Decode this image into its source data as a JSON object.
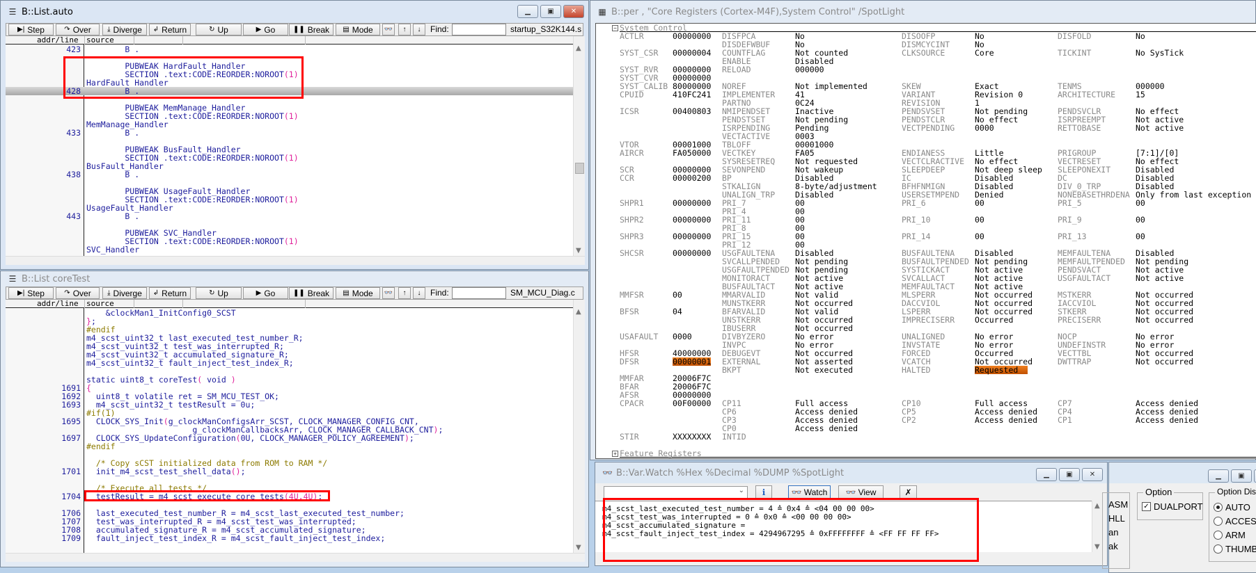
{
  "toolbar": {
    "step": "Step",
    "over": "Over",
    "diverge": "Diverge",
    "return": "Return",
    "up": "Up",
    "go": "Go",
    "break": "Break",
    "mode": "Mode",
    "find": "Find:"
  },
  "list_header": {
    "addr": "addr/line",
    "source": "source"
  },
  "list_top": {
    "title": "B::List.auto",
    "file": "startup_S32K144.s",
    "lines": [
      {
        "n": "423",
        "t": "        B ."
      },
      {
        "n": "",
        "t": ""
      },
      {
        "n": "",
        "t": "        PUBWEAK HardFault_Handler"
      },
      {
        "n": "",
        "t": "        SECTION .text:CODE:REORDER:NOROOT(1)"
      },
      {
        "n": "",
        "t": "HardFault_Handler"
      },
      {
        "n": "428",
        "t": "        B .",
        "cur": true
      },
      {
        "n": "",
        "t": ""
      },
      {
        "n": "",
        "t": "        PUBWEAK MemManage_Handler"
      },
      {
        "n": "",
        "t": "        SECTION .text:CODE:REORDER:NOROOT(1)"
      },
      {
        "n": "",
        "t": "MemManage_Handler"
      },
      {
        "n": "433",
        "t": "        B ."
      },
      {
        "n": "",
        "t": ""
      },
      {
        "n": "",
        "t": "        PUBWEAK BusFault_Handler"
      },
      {
        "n": "",
        "t": "        SECTION .text:CODE:REORDER:NOROOT(1)"
      },
      {
        "n": "",
        "t": "BusFault_Handler"
      },
      {
        "n": "438",
        "t": "        B ."
      },
      {
        "n": "",
        "t": ""
      },
      {
        "n": "",
        "t": "        PUBWEAK UsageFault_Handler"
      },
      {
        "n": "",
        "t": "        SECTION .text:CODE:REORDER:NOROOT(1)"
      },
      {
        "n": "",
        "t": "UsageFault_Handler"
      },
      {
        "n": "443",
        "t": "        B ."
      },
      {
        "n": "",
        "t": ""
      },
      {
        "n": "",
        "t": "        PUBWEAK SVC_Handler"
      },
      {
        "n": "",
        "t": "        SECTION .text:CODE:REORDER:NOROOT(1)"
      },
      {
        "n": "",
        "t": "SVC_Handler"
      }
    ]
  },
  "list_bottom": {
    "title": "B::List coreTest",
    "file": "SM_MCU_Diag.c",
    "lines": [
      {
        "n": "",
        "t": "    &clockMan1_InitConfig0_SCST"
      },
      {
        "n": "",
        "t": "};"
      },
      {
        "n": "",
        "t": "#endif"
      },
      {
        "n": "",
        "t": "m4_scst_uint32_t last_executed_test_number_R;"
      },
      {
        "n": "",
        "t": "m4_scst_vuint32_t test_was_interrupted_R;"
      },
      {
        "n": "",
        "t": "m4_scst_vuint32_t accumulated_signature_R;"
      },
      {
        "n": "",
        "t": "m4_scst_uint32_t fault_inject_test_index_R;"
      },
      {
        "n": "",
        "t": ""
      },
      {
        "n": "",
        "t": "static uint8_t coreTest( void )"
      },
      {
        "n": "1691",
        "t": "{"
      },
      {
        "n": "1692",
        "t": "  uint8_t volatile ret = SM_MCU_TEST_OK;"
      },
      {
        "n": "1693",
        "t": "  m4_scst_uint32_t testResult = 0u;"
      },
      {
        "n": "",
        "t": "#if(1)"
      },
      {
        "n": "1695",
        "t": "  CLOCK_SYS_Init(g_clockManConfigsArr_SCST, CLOCK_MANAGER_CONFIG_CNT,"
      },
      {
        "n": "",
        "t": "                      g_clockManCallbacksArr, CLOCK_MANAGER_CALLBACK_CNT);"
      },
      {
        "n": "1697",
        "t": "  CLOCK_SYS_UpdateConfiguration(0U, CLOCK_MANAGER_POLICY_AGREEMENT);"
      },
      {
        "n": "",
        "t": "#endif"
      },
      {
        "n": "",
        "t": ""
      },
      {
        "n": "",
        "t": "  /* Copy sCST initialized data from ROM to RAM */"
      },
      {
        "n": "1701",
        "t": "  init_m4_scst_test_shell_data();"
      },
      {
        "n": "",
        "t": ""
      },
      {
        "n": "",
        "t": "  /* Execute all tests */"
      },
      {
        "n": "1704",
        "t": "  testResult = m4_scst_execute_core_tests(4U,4U);"
      },
      {
        "n": "",
        "t": ""
      },
      {
        "n": "1706",
        "t": "  last_executed_test_number_R = m4_scst_last_executed_test_number;"
      },
      {
        "n": "1707",
        "t": "  test_was_interrupted_R = m4_scst_test_was_interrupted;"
      },
      {
        "n": "1708",
        "t": "  accumulated_signature_R = m4_scst_accumulated_signature;"
      },
      {
        "n": "1709",
        "t": "  fault_inject_test_index_R = m4_scst_fault_inject_test_index;"
      }
    ]
  },
  "registers": {
    "title": "B::per , \"Core Registers (Cortex-M4F),System Control\" /SpotLight",
    "section": "System Control",
    "footer_section": "Feature Registers",
    "rows": [
      {
        "r": "ACTLR",
        "v": "00000000",
        "f": [
          [
            "DISFPCA",
            "No"
          ],
          [
            "DISOOFP",
            "No"
          ],
          [
            "DISFOLD",
            "No"
          ]
        ]
      },
      {
        "r": "",
        "v": "",
        "f": [
          [
            "DISDEFWBUF",
            "No"
          ],
          [
            "DISMCYCINT",
            "No"
          ]
        ]
      },
      {
        "r": "SYST_CSR",
        "v": "00000004",
        "f": [
          [
            "COUNTFLAG",
            "Not counted"
          ],
          [
            "CLKSOURCE",
            "Core"
          ],
          [
            "TICKINT",
            "No SysTick"
          ]
        ]
      },
      {
        "r": "",
        "v": "",
        "f": [
          [
            "ENABLE",
            "Disabled"
          ]
        ]
      },
      {
        "r": "SYST_RVR",
        "v": "00000000",
        "f": [
          [
            "RELOAD",
            "000000"
          ]
        ]
      },
      {
        "r": "SYST_CVR",
        "v": "00000000",
        "f": []
      },
      {
        "r": "SYST_CALIB",
        "v": "80000000",
        "f": [
          [
            "NOREF",
            "Not implemented"
          ],
          [
            "SKEW",
            "Exact"
          ],
          [
            "TENMS",
            "000000"
          ]
        ]
      },
      {
        "r": "CPUID",
        "v": "410FC241",
        "f": [
          [
            "IMPLEMENTER",
            "41"
          ],
          [
            "VARIANT",
            "Revision 0"
          ],
          [
            "ARCHITECTURE",
            "15"
          ]
        ]
      },
      {
        "r": "",
        "v": "",
        "f": [
          [
            "PARTNO",
            "0C24"
          ],
          [
            "REVISION",
            "1"
          ]
        ]
      },
      {
        "r": "ICSR",
        "v": "00400803",
        "f": [
          [
            "NMIPENDSET",
            "Inactive"
          ],
          [
            "PENDSVSET",
            "Not pending"
          ],
          [
            "PENDSVCLR",
            "No effect"
          ]
        ]
      },
      {
        "r": "",
        "v": "",
        "f": [
          [
            "PENDSTSET",
            "Not pending"
          ],
          [
            "PENDSTCLR",
            "No effect"
          ],
          [
            "ISRPREEMPT",
            "Not active"
          ]
        ]
      },
      {
        "r": "",
        "v": "",
        "f": [
          [
            "ISRPENDING",
            "Pending"
          ],
          [
            "VECTPENDING",
            "0000"
          ],
          [
            "RETTOBASE",
            "Not active"
          ]
        ]
      },
      {
        "r": "",
        "v": "",
        "f": [
          [
            "VECTACTIVE",
            "0003"
          ]
        ]
      },
      {
        "r": "VTOR",
        "v": "00001000",
        "f": [
          [
            "TBLOFF",
            "00001000"
          ]
        ]
      },
      {
        "r": "AIRCR",
        "v": "FA050000",
        "f": [
          [
            "VECTKEY",
            "FA05"
          ],
          [
            "ENDIANESS",
            "Little"
          ],
          [
            "PRIGROUP",
            "[7:1]/[0]"
          ]
        ]
      },
      {
        "r": "",
        "v": "",
        "f": [
          [
            "SYSRESETREQ",
            "Not requested"
          ],
          [
            "VECTCLRACTIVE",
            "No effect"
          ],
          [
            "VECTRESET",
            "No effect"
          ]
        ]
      },
      {
        "r": "SCR",
        "v": "00000000",
        "f": [
          [
            "SEVONPEND",
            "Not wakeup"
          ],
          [
            "SLEEPDEEP",
            "Not deep sleep"
          ],
          [
            "SLEEPONEXIT",
            "Disabled"
          ]
        ]
      },
      {
        "r": "CCR",
        "v": "00000200",
        "f": [
          [
            "BP",
            "Disabled"
          ],
          [
            "IC",
            "Disabled"
          ],
          [
            "DC",
            "Disabled"
          ]
        ]
      },
      {
        "r": "",
        "v": "",
        "f": [
          [
            "STKALIGN",
            "8-byte/adjustment"
          ],
          [
            "BFHFNMIGN",
            "Disabled"
          ],
          [
            "DIV_0_TRP",
            "Disabled"
          ]
        ]
      },
      {
        "r": "",
        "v": "",
        "f": [
          [
            "UNALIGN_TRP",
            "Disabled"
          ],
          [
            "USERSETMPEND",
            "Denied"
          ],
          [
            "NONEBASETHRDENA",
            "Only from last exception"
          ]
        ]
      },
      {
        "r": "SHPR1",
        "v": "00000000",
        "f": [
          [
            "PRI_7",
            "00"
          ],
          [
            "PRI_6",
            "00"
          ],
          [
            "PRI_5",
            "00"
          ]
        ]
      },
      {
        "r": "",
        "v": "",
        "f": [
          [
            "PRI_4",
            "00"
          ]
        ]
      },
      {
        "r": "SHPR2",
        "v": "00000000",
        "f": [
          [
            "PRI_11",
            "00"
          ],
          [
            "PRI_10",
            "00"
          ],
          [
            "PRI_9",
            "00"
          ]
        ]
      },
      {
        "r": "",
        "v": "",
        "f": [
          [
            "PRI_8",
            "00"
          ]
        ]
      },
      {
        "r": "SHPR3",
        "v": "00000000",
        "f": [
          [
            "PRI_15",
            "00"
          ],
          [
            "PRI_14",
            "00"
          ],
          [
            "PRI_13",
            "00"
          ]
        ]
      },
      {
        "r": "",
        "v": "",
        "f": [
          [
            "PRI_12",
            "00"
          ]
        ]
      },
      {
        "r": "SHCSR",
        "v": "00000000",
        "f": [
          [
            "USGFAULTENA",
            "Disabled"
          ],
          [
            "BUSFAULTENA",
            "Disabled"
          ],
          [
            "MEMFAULTENA",
            "Disabled"
          ]
        ]
      },
      {
        "r": "",
        "v": "",
        "f": [
          [
            "SVCALLPENDED",
            "Not pending"
          ],
          [
            "BUSFAULTPENDED",
            "Not pending"
          ],
          [
            "MEMFAULTPENDED",
            "Not pending"
          ]
        ]
      },
      {
        "r": "",
        "v": "",
        "f": [
          [
            "USGFAULTPENDED",
            "Not pending"
          ],
          [
            "SYSTICKACT",
            "Not active"
          ],
          [
            "PENDSVACT",
            "Not active"
          ]
        ]
      },
      {
        "r": "",
        "v": "",
        "f": [
          [
            "MONITORACT",
            "Not active"
          ],
          [
            "SVCALLACT",
            "Not active"
          ],
          [
            "USGFAULTACT",
            "Not active"
          ]
        ]
      },
      {
        "r": "",
        "v": "",
        "f": [
          [
            "BUSFAULTACT",
            "Not active"
          ],
          [
            "MEMFAULTACT",
            "Not active"
          ]
        ]
      },
      {
        "r": "MMFSR",
        "v": "00",
        "f": [
          [
            "MMARVALID",
            "Not valid"
          ],
          [
            "MLSPERR",
            "Not occurred"
          ],
          [
            "MSTKERR",
            "Not occurred"
          ]
        ]
      },
      {
        "r": "",
        "v": "",
        "f": [
          [
            "MUNSTKERR",
            "Not occurred"
          ],
          [
            "DACCVIOL",
            "Not occurred"
          ],
          [
            "IACCVIOL",
            "Not occurred"
          ]
        ]
      },
      {
        "r": "BFSR",
        "v": "04",
        "f": [
          [
            "BFARVALID",
            "Not valid"
          ],
          [
            "LSPERR",
            "Not occurred"
          ],
          [
            "STKERR",
            "Not occurred"
          ]
        ]
      },
      {
        "r": "",
        "v": "",
        "f": [
          [
            "UNSTKERR",
            "Not occurred"
          ],
          [
            "IMPRECISERR",
            "Occurred"
          ],
          [
            "PRECISERR",
            "Not occurred"
          ]
        ]
      },
      {
        "r": "",
        "v": "",
        "f": [
          [
            "IBUSERR",
            "Not occurred"
          ]
        ]
      },
      {
        "r": "USAFAULT",
        "v": "0000",
        "f": [
          [
            "DIVBYZERO",
            "No error"
          ],
          [
            "UNALIGNED",
            "No error"
          ],
          [
            "NOCP",
            "No error"
          ]
        ]
      },
      {
        "r": "",
        "v": "",
        "f": [
          [
            "INVPC",
            "No error"
          ],
          [
            "INVSTATE",
            "No error"
          ],
          [
            "UNDEFINSTR",
            "No error"
          ]
        ]
      },
      {
        "r": "HFSR",
        "v": "40000000",
        "f": [
          [
            "DEBUGEVT",
            "Not occurred"
          ],
          [
            "FORCED",
            "Occurred"
          ],
          [
            "VECTTBL",
            "Not occurred"
          ]
        ]
      },
      {
        "r": "DFSR",
        "v": "00000001",
        "vhl": true,
        "f": [
          [
            "EXTERNAL",
            "Not asserted"
          ],
          [
            "VCATCH",
            "Not occurred"
          ],
          [
            "DWTTRAP",
            "Not occurred"
          ]
        ]
      },
      {
        "r": "",
        "v": "",
        "f": [
          [
            "BKPT",
            "Not executed"
          ],
          [
            "HALTED",
            "Requested",
            true
          ]
        ]
      },
      {
        "r": "MMFAR",
        "v": "20006F7C",
        "f": []
      },
      {
        "r": "BFAR",
        "v": "20006F7C",
        "f": []
      },
      {
        "r": "AFSR",
        "v": "00000000",
        "f": []
      },
      {
        "r": "CPACR",
        "v": "00F00000",
        "f": [
          [
            "CP11",
            "Full access"
          ],
          [
            "CP10",
            "Full access"
          ],
          [
            "CP7",
            "Access denied"
          ]
        ]
      },
      {
        "r": "",
        "v": "",
        "f": [
          [
            "CP6",
            "Access denied"
          ],
          [
            "CP5",
            "Access denied"
          ],
          [
            "CP4",
            "Access denied"
          ]
        ]
      },
      {
        "r": "",
        "v": "",
        "f": [
          [
            "CP3",
            "Access denied"
          ],
          [
            "CP2",
            "Access denied"
          ],
          [
            "CP1",
            "Access denied"
          ]
        ]
      },
      {
        "r": "",
        "v": "",
        "f": [
          [
            "CP0",
            "Access denied"
          ]
        ]
      },
      {
        "r": "STIR",
        "v": "XXXXXXXX",
        "f": [
          [
            "INTID",
            ""
          ]
        ]
      }
    ]
  },
  "watch": {
    "title": "B::Var.Watch %Hex %Decimal %DUMP %SpotLight",
    "watch_btn": "Watch",
    "view_btn": "View",
    "lines": [
      "m4_scst_last_executed_test_number = 4 ≙ 0x4 ≙ <04 00 00 00>",
      "m4_scst_test_was_interrupted = 0 ≙ 0x0 ≙ <00 00 00 00>",
      "m4_scst_accumulated_signature =",
      "m4_scst_fault_inject_test_index = 4294967295 ≙ 0xFFFFFFFF ≙ <FF FF FF FF>"
    ]
  },
  "options_window": {
    "partial_items": [
      "ASM",
      "HLL",
      "an",
      "ak"
    ],
    "option_group": "Option",
    "dualport": "DUALPORT",
    "dualport_checked": true,
    "dismode_group": "Option DisMode",
    "dismodes": [
      "AUTO",
      "ACCESS",
      "ARM",
      "THUMB"
    ],
    "dismode_selected": "AUTO"
  },
  "colors": {
    "highlight": "#e06810",
    "annotation": "#ff0000",
    "code": "#1c1c9c",
    "paren": "#e0209b",
    "preproc": "#8c7a00"
  }
}
